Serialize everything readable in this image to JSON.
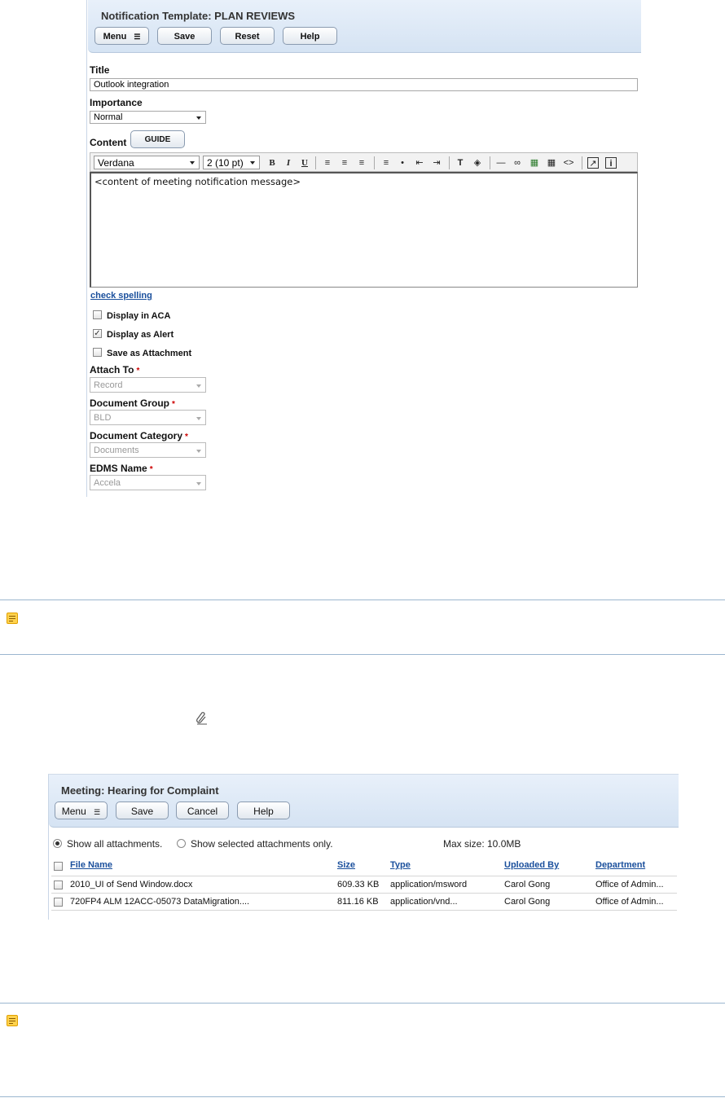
{
  "notification_template": {
    "title": "Notification Template: PLAN REVIEWS",
    "buttons": {
      "menu": "Menu",
      "save": "Save",
      "reset": "Reset",
      "help": "Help"
    },
    "fields": {
      "title_label": "Title",
      "title_value": "Outlook integration",
      "importance_label": "Importance",
      "importance_value": "Normal",
      "content_label": "Content",
      "guide_button": "GUIDE"
    },
    "editor": {
      "font": "Verdana",
      "size": "2 (10 pt)",
      "content": "<content of meeting notification message>"
    },
    "check_spelling": "check spelling",
    "checkboxes": [
      {
        "label": "Display in ACA",
        "checked": false
      },
      {
        "label": "Display as Alert",
        "checked": true
      },
      {
        "label": "Save as Attachment",
        "checked": false
      }
    ],
    "selects": [
      {
        "label": "Attach To",
        "value": "Record",
        "required": "*"
      },
      {
        "label": "Document Group",
        "value": "BLD",
        "required": "*"
      },
      {
        "label": "Document Category",
        "value": "Documents",
        "required": "*"
      },
      {
        "label": "EDMS Name",
        "value": "Accela",
        "required": "*"
      }
    ]
  },
  "meeting": {
    "title": "Meeting: Hearing for Complaint",
    "buttons": {
      "menu": "Menu",
      "save": "Save",
      "cancel": "Cancel",
      "help": "Help"
    },
    "options": {
      "show_all": "Show all attachments.",
      "show_selected": "Show selected attachments only.",
      "max_size": "Max size: 10.0MB"
    },
    "columns": [
      "File Name",
      "Size",
      "Type",
      "Uploaded By",
      "Department"
    ],
    "rows": [
      {
        "file": "2010_UI of Send Window.docx",
        "size": "609.33 KB",
        "type": "application/msword",
        "uploaded_by": "Carol Gong",
        "department": "Office of Admin..."
      },
      {
        "file": "720FP4 ALM 12ACC-05073 DataMigration....",
        "size": "811.16 KB",
        "type": "application/vnd...",
        "uploaded_by": "Carol Gong",
        "department": "Office of Admin..."
      }
    ]
  },
  "icons": {
    "note": "note-icon",
    "attachment": "paperclip-icon"
  },
  "colors": {
    "header_bg": "#dbe6f4",
    "link": "#1a4f9c",
    "note_line": "#9bb6cf",
    "note_icon": "#ffd24d",
    "required": "#cc0000"
  }
}
